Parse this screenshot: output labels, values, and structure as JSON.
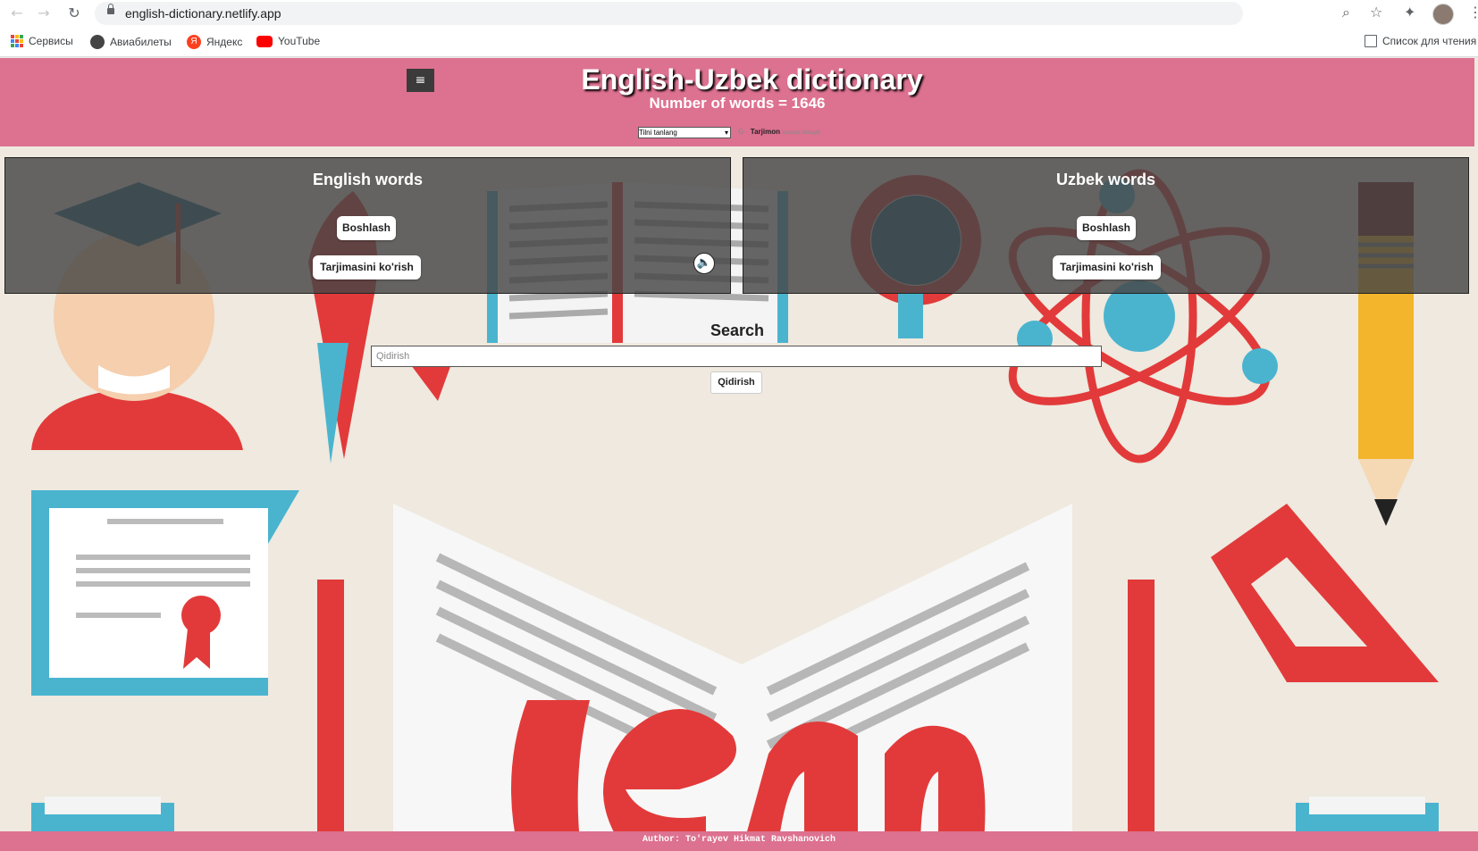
{
  "browser": {
    "url": "english-dictionary.netlify.app",
    "bookmarks": [
      {
        "label": "Сервисы",
        "icon": "apps-grid-icon"
      },
      {
        "label": "Авиабилеты",
        "icon": "globe-icon"
      },
      {
        "label": "Яндекс",
        "icon": "yandex-icon"
      },
      {
        "label": "YouTube",
        "icon": "youtube-icon"
      }
    ],
    "reading_list": "Список для чтения"
  },
  "header": {
    "title": "English-Uzbek dictionary",
    "word_count": "Number of words = 1646",
    "language_select": "Tilni tanlang",
    "translate_powered": "Tarjimon",
    "translate_suffix": "asosida ishlaydi"
  },
  "panels": {
    "english": {
      "title": "English words",
      "start_label": "Boshlash",
      "translate_label": "Tarjimasini ko'rish"
    },
    "uzbek": {
      "title": "Uzbek words",
      "start_label": "Boshlash",
      "translate_label": "Tarjimasini ko'rish"
    }
  },
  "search": {
    "heading": "Search",
    "placeholder": "Qidirish",
    "button_label": "Qidirish"
  },
  "footer": {
    "author": "Author: To'rayev Hikmat Ravshanovich"
  },
  "colors": {
    "header_pink": "#dd7190",
    "panel_overlay": "#464646"
  }
}
